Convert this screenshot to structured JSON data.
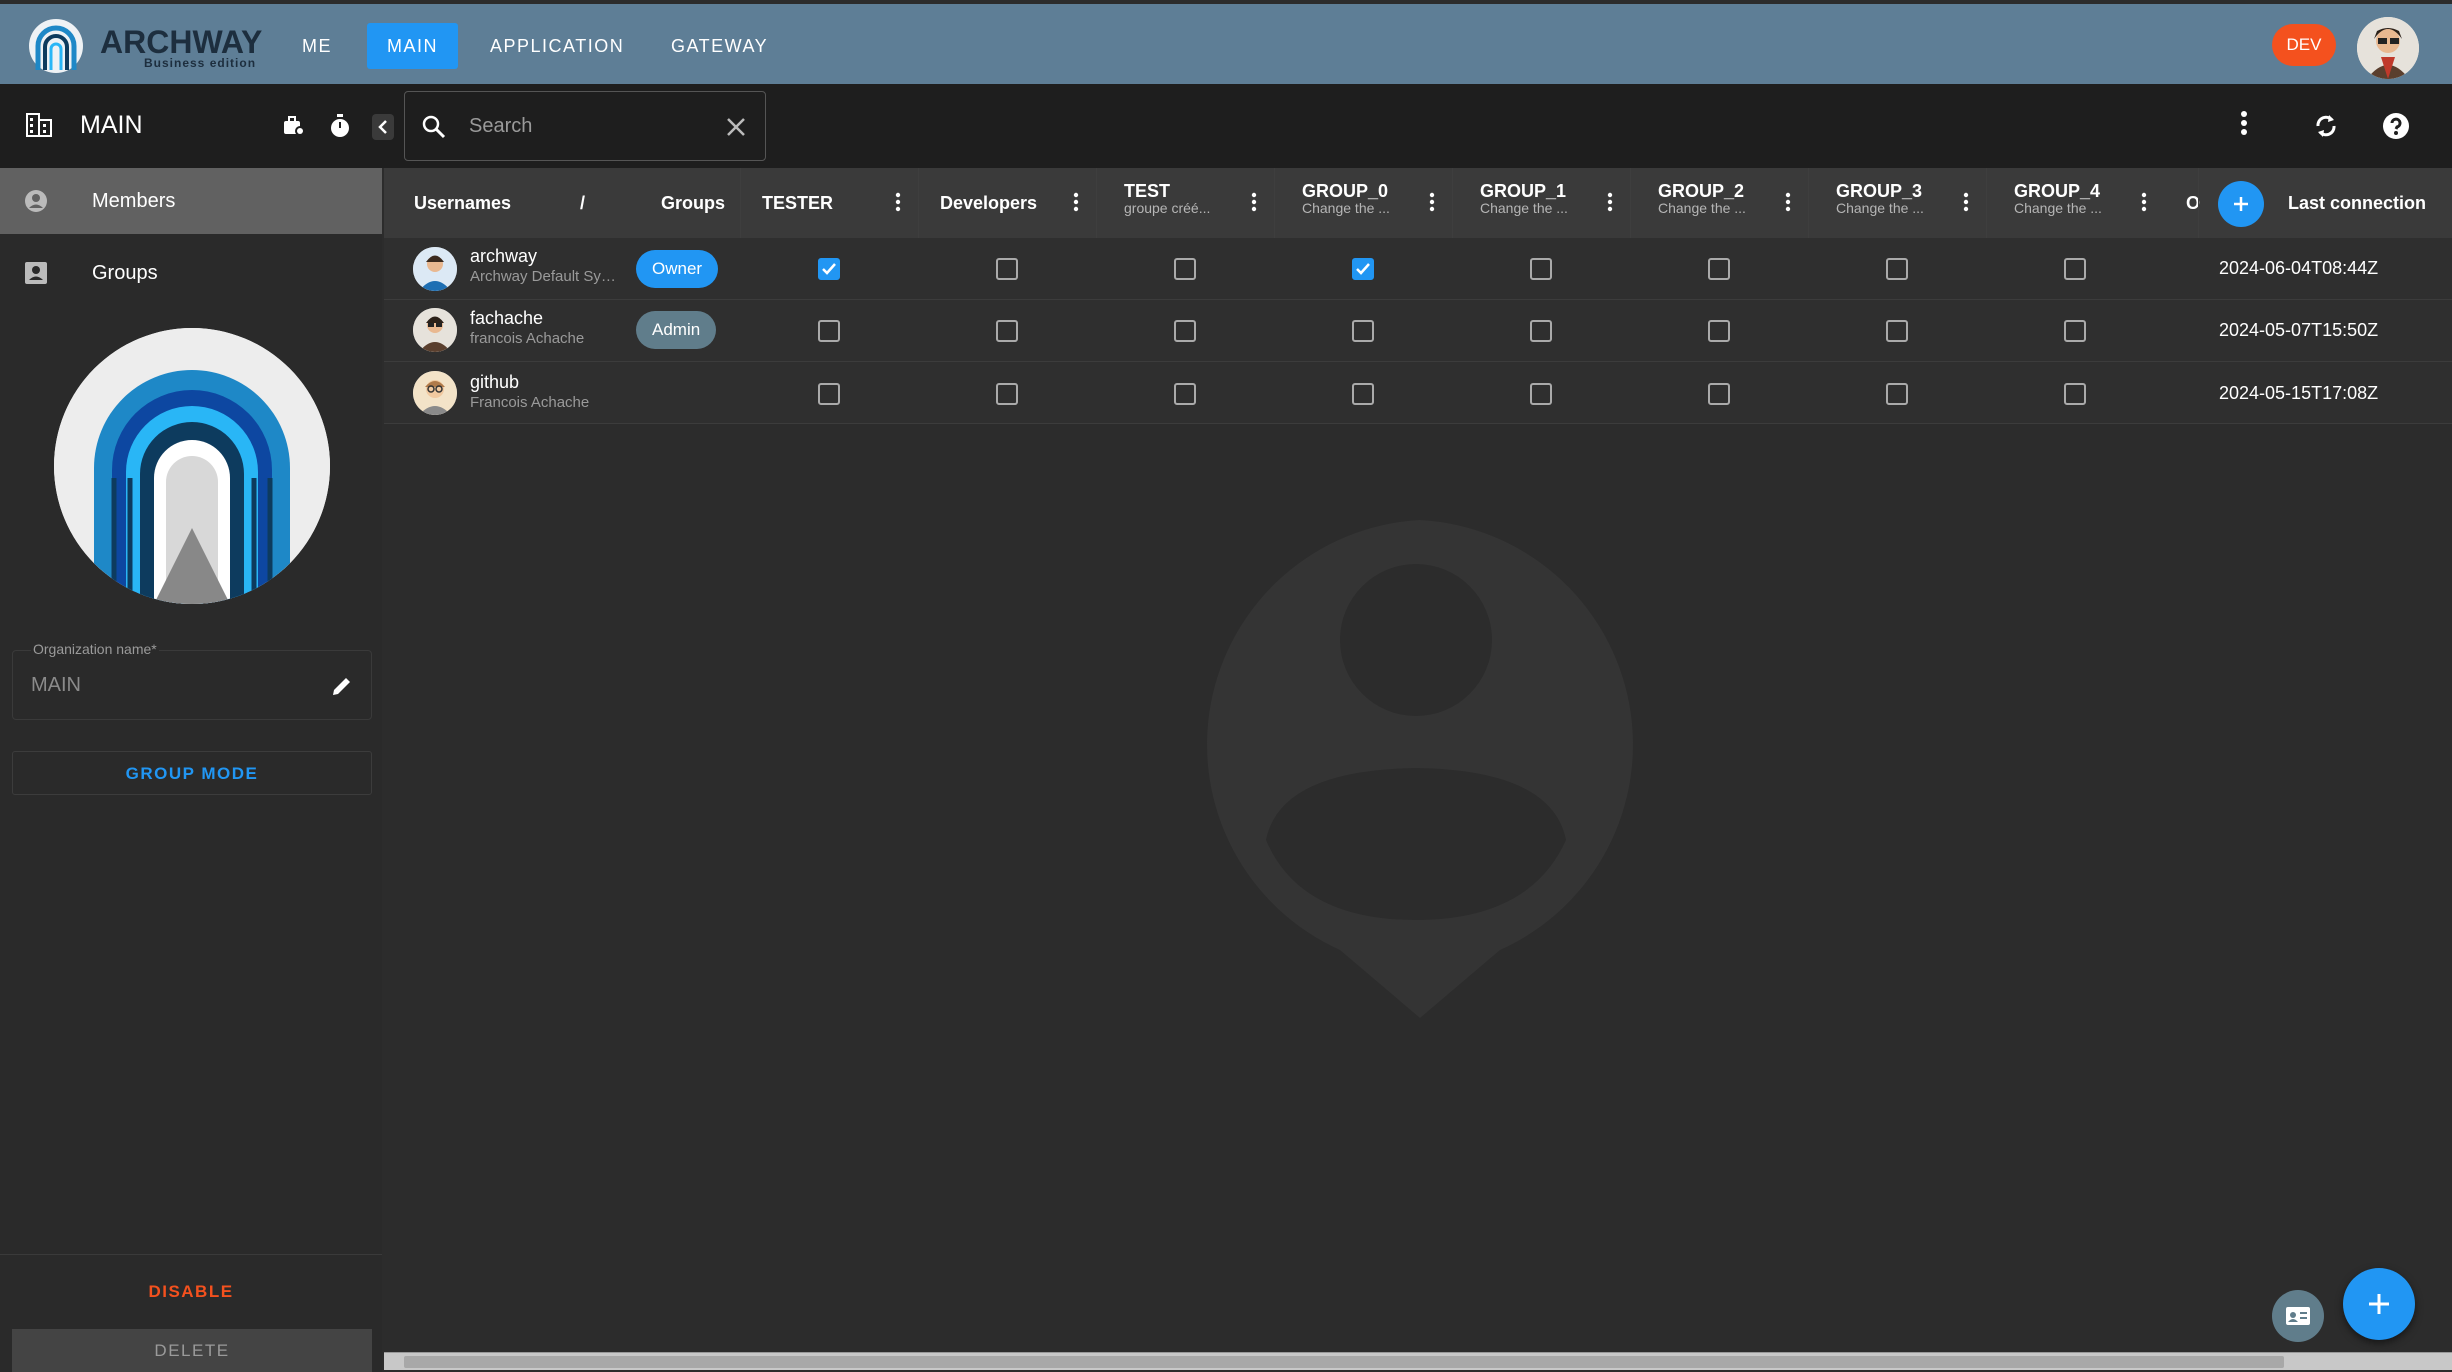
{
  "app": {
    "brand": "ARCHWAY",
    "edition": "Business edition"
  },
  "nav": {
    "tabs": [
      {
        "label": "ME"
      },
      {
        "label": "MAIN",
        "active": true
      },
      {
        "label": "APPLICATION"
      },
      {
        "label": "GATEWAY"
      }
    ],
    "env_label": "DEV"
  },
  "toolbar": {
    "title": "MAIN",
    "search_placeholder": "Search"
  },
  "sidebar": {
    "items": [
      {
        "label": "Members",
        "icon": "person-circle-icon",
        "active": true
      },
      {
        "label": "Groups",
        "icon": "contact-card-icon"
      }
    ],
    "org_field_label": "Organization name*",
    "org_name": "MAIN",
    "group_mode_label": "GROUP MODE",
    "disable_label": "DISABLE",
    "delete_label": "DELETE"
  },
  "table": {
    "user_header": {
      "usernames": "Usernames",
      "sep": "/",
      "groups": "Groups"
    },
    "groups": [
      {
        "name": "TESTER",
        "desc": ""
      },
      {
        "name": "Developers",
        "desc": ""
      },
      {
        "name": "TEST",
        "desc": "groupe créé..."
      },
      {
        "name": "GROUP_0",
        "desc": "Change the ..."
      },
      {
        "name": "GROUP_1",
        "desc": "Change the ..."
      },
      {
        "name": "GROUP_2",
        "desc": "Change the ..."
      },
      {
        "name": "GROUP_3",
        "desc": "Change the ..."
      },
      {
        "name": "GROUP_4",
        "desc": "Change the ..."
      }
    ],
    "overflow_col": "O",
    "last_connection_header": "Last connection",
    "rows": [
      {
        "username": "archway",
        "fullname": "Archway Default Sys...",
        "role": "Owner",
        "checks": [
          true,
          false,
          false,
          true,
          false,
          false,
          false,
          false
        ],
        "last_connection": "2024-06-04T08:44Z"
      },
      {
        "username": "fachache",
        "fullname": "francois Achache",
        "role": "Admin",
        "checks": [
          false,
          false,
          false,
          false,
          false,
          false,
          false,
          false
        ],
        "last_connection": "2024-05-07T15:50Z"
      },
      {
        "username": "github",
        "fullname": "Francois Achache",
        "role": "",
        "checks": [
          false,
          false,
          false,
          false,
          false,
          false,
          false,
          false
        ],
        "last_connection": "2024-05-15T17:08Z"
      }
    ]
  },
  "colors": {
    "accent": "#2196f3",
    "topbar": "#5e7e96",
    "danger": "#f4511e"
  }
}
